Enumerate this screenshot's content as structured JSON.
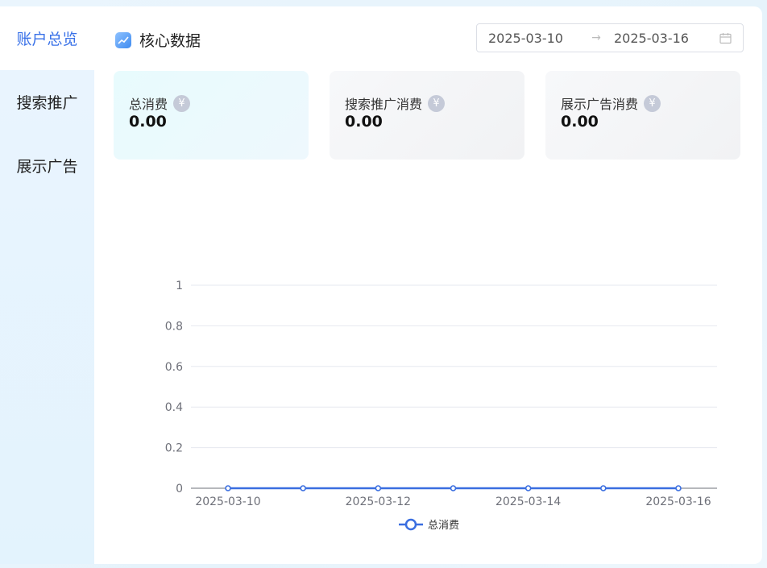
{
  "sidebar": {
    "items": [
      {
        "label": "账户总览",
        "active": true
      },
      {
        "label": "搜索推广",
        "active": false
      },
      {
        "label": "展示广告",
        "active": false
      }
    ]
  },
  "header": {
    "title": "核心数据",
    "date_start": "2025-03-10",
    "date_separator": "→",
    "date_end": "2025-03-16",
    "icon": "trend-chart-icon",
    "calendar_icon": "calendar-icon"
  },
  "cards": [
    {
      "label": "总消费",
      "value": "0.00",
      "icon": "¥"
    },
    {
      "label": "搜索推广消费",
      "value": "0.00",
      "icon": "¥"
    },
    {
      "label": "展示广告消费",
      "value": "0.00",
      "icon": "¥"
    }
  ],
  "colors": {
    "accent": "#3a72e8",
    "line": "#3a6ee0",
    "grid": "#e6e8ef"
  },
  "chart_data": {
    "type": "line",
    "x": [
      "2025-03-10",
      "2025-03-11",
      "2025-03-12",
      "2025-03-13",
      "2025-03-14",
      "2025-03-15",
      "2025-03-16"
    ],
    "x_tick_labels": [
      "2025-03-10",
      "2025-03-12",
      "2025-03-14",
      "2025-03-16"
    ],
    "series": [
      {
        "name": "总消费",
        "values": [
          0,
          0,
          0,
          0,
          0,
          0,
          0
        ]
      }
    ],
    "y_ticks": [
      "1",
      "0.8",
      "0.6",
      "0.4",
      "0.2",
      "0"
    ],
    "ylim": [
      0,
      1
    ],
    "grid": true,
    "legend_position": "bottom"
  }
}
